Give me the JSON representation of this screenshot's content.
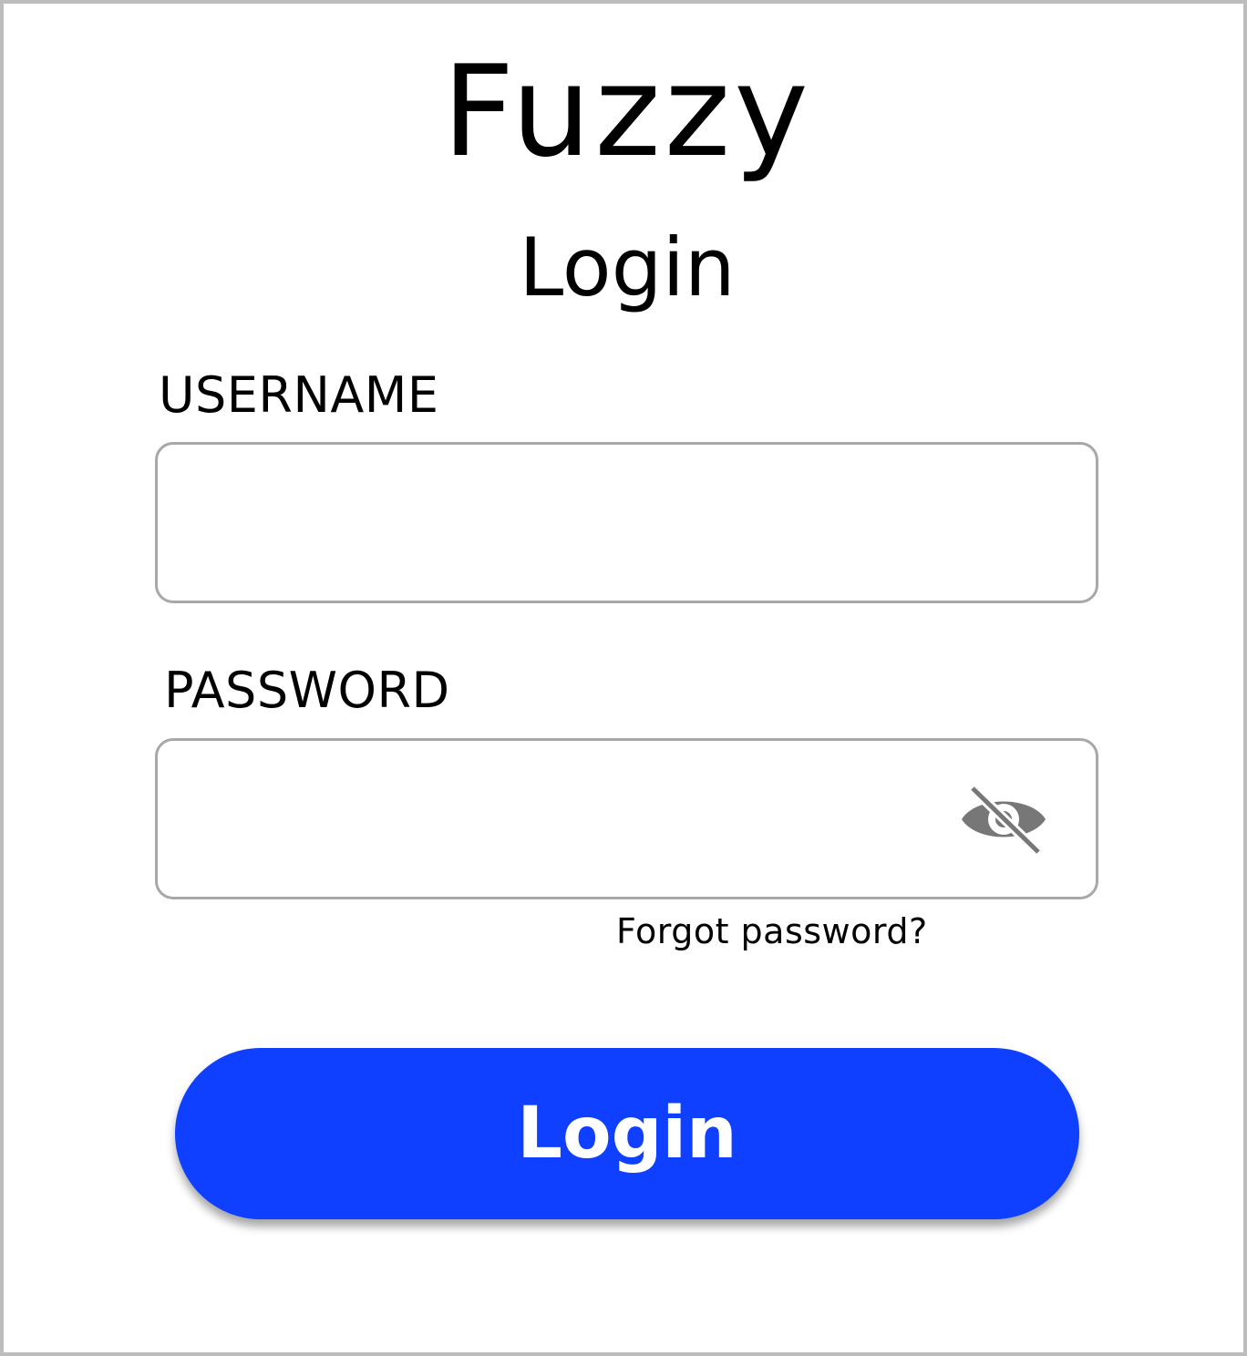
{
  "app": {
    "title": "Fuzzy"
  },
  "page": {
    "title": "Login"
  },
  "form": {
    "username": {
      "label": "USERNAME",
      "value": ""
    },
    "password": {
      "label": "PASSWORD",
      "value": "",
      "visibility_icon": "eye-off-icon"
    },
    "forgot_password_label": "Forgot password?",
    "submit_label": "Login"
  },
  "colors": {
    "primary_button": "#0f40ff",
    "field_border": "#a8a8a8",
    "icon": "#777777"
  }
}
